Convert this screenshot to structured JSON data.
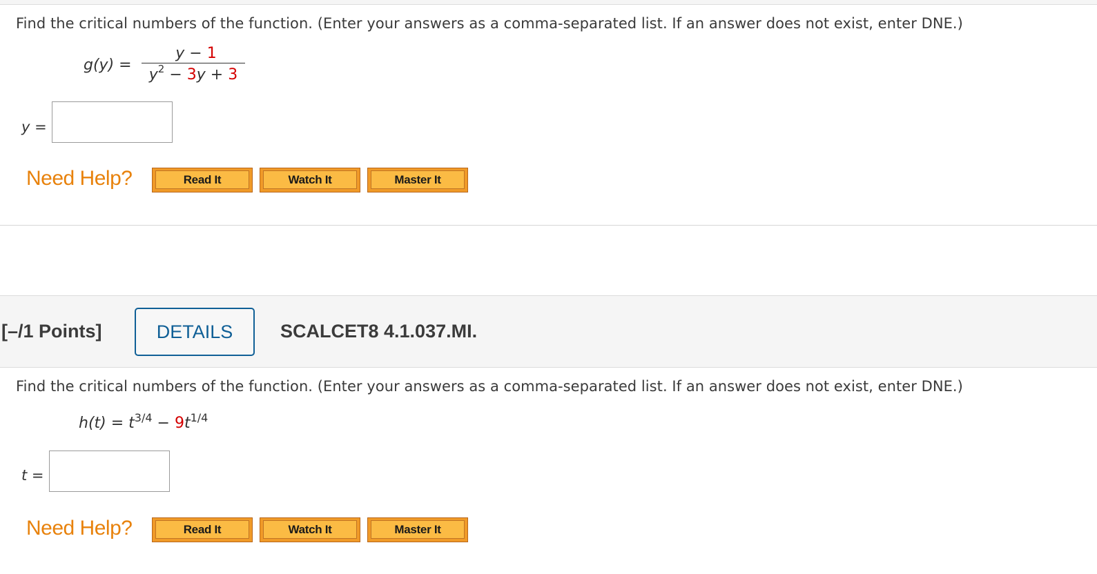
{
  "question1": {
    "prompt": "Find the critical numbers of the function. (Enter your answers as a comma-separated list. If an answer does not exist, enter DNE.)",
    "function": {
      "lhs": "g(y) =",
      "numerator": {
        "var": "y",
        "op": " − ",
        "const": "1"
      },
      "denominator": {
        "var": "y",
        "exp": "2",
        "op1": " − ",
        "coef": "3",
        "var2": "y",
        "op2": " + ",
        "const": "3"
      }
    },
    "answer": {
      "label": "y =",
      "value": "",
      "placeholder": ""
    },
    "help": {
      "label": "Need Help?",
      "buttons": [
        "Read It",
        "Watch It",
        "Master It"
      ]
    }
  },
  "question2": {
    "header": {
      "points": "[–/1 Points]",
      "details_label": "DETAILS",
      "code": "SCALCET8 4.1.037.MI."
    },
    "prompt": "Find the critical numbers of the function. (Enter your answers as a comma-separated list. If an answer does not exist, enter DNE.)",
    "function": {
      "lhs": "h(t) = ",
      "term1_var": "t",
      "term1_exp": "3/4",
      "op": " − ",
      "coef": "9",
      "term2_var": "t",
      "term2_exp": "1/4"
    },
    "answer": {
      "label": "t =",
      "value": "",
      "placeholder": ""
    },
    "help": {
      "label": "Need Help?",
      "buttons": [
        "Read It",
        "Watch It",
        "Master It"
      ]
    }
  },
  "colors": {
    "highlight_red": "#d40000",
    "need_help_orange": "#e8820c",
    "details_blue": "#0f5f96",
    "button_orange": "#fbbb44"
  }
}
